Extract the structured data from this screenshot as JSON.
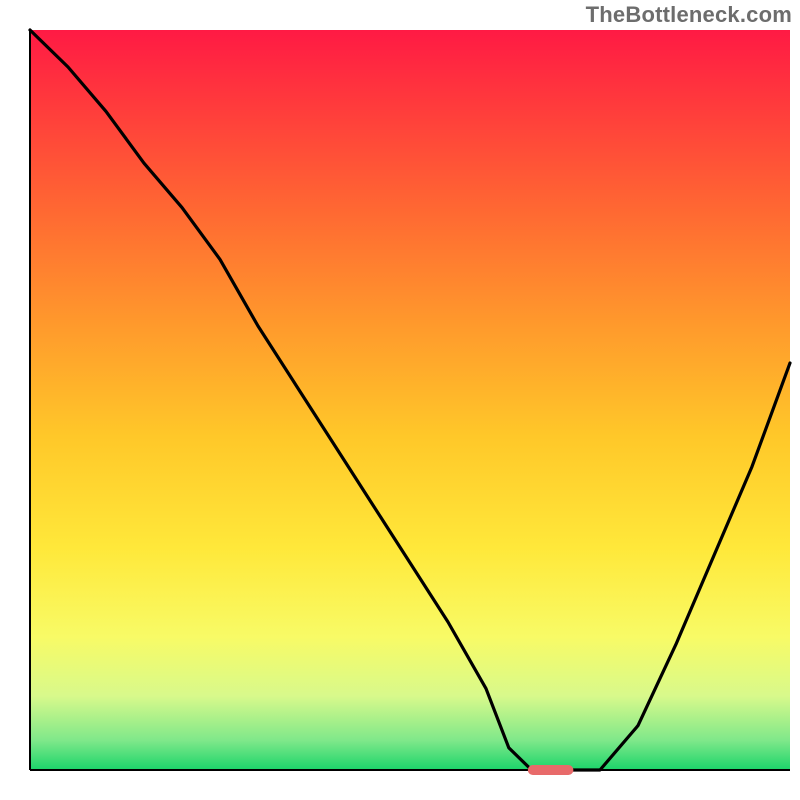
{
  "watermark": "TheBottleneck.com",
  "chart_data": {
    "type": "line",
    "title": "",
    "xlabel": "",
    "ylabel": "",
    "xlim": [
      0,
      100
    ],
    "ylim": [
      0,
      100
    ],
    "x": [
      0,
      5,
      10,
      15,
      20,
      25,
      30,
      35,
      40,
      45,
      50,
      55,
      60,
      63,
      66,
      70,
      75,
      80,
      85,
      90,
      95,
      100
    ],
    "values": [
      100,
      95,
      89,
      82,
      76,
      69,
      60,
      52,
      44,
      36,
      28,
      20,
      11,
      3,
      0,
      0,
      0,
      6,
      17,
      29,
      41,
      55
    ],
    "indicator": {
      "x_center": 68.5,
      "width_pct": 6,
      "y": 0
    },
    "gradient_stops": [
      {
        "offset": 0.0,
        "color": "#ff1a44"
      },
      {
        "offset": 0.1,
        "color": "#ff3a3c"
      },
      {
        "offset": 0.25,
        "color": "#ff6a32"
      },
      {
        "offset": 0.4,
        "color": "#ff9a2c"
      },
      {
        "offset": 0.55,
        "color": "#ffc829"
      },
      {
        "offset": 0.7,
        "color": "#ffe83a"
      },
      {
        "offset": 0.82,
        "color": "#f8fb66"
      },
      {
        "offset": 0.9,
        "color": "#d8f98b"
      },
      {
        "offset": 0.96,
        "color": "#7fe88a"
      },
      {
        "offset": 1.0,
        "color": "#1bd46a"
      }
    ]
  },
  "layout": {
    "outer": 800,
    "inner_x": 30,
    "inner_y": 30,
    "inner_w": 760,
    "inner_h": 740,
    "axis_stroke": "#000000",
    "axis_width": 2,
    "curve_stroke": "#000000",
    "curve_width": 3.2,
    "indicator_color": "#e86a6a",
    "indicator_height": 10,
    "indicator_radius": 5
  }
}
